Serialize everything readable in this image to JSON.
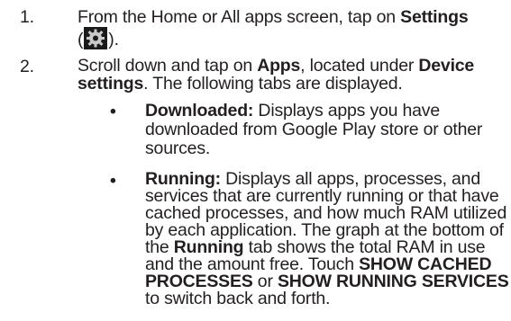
{
  "steps": [
    {
      "number": "1.",
      "text_before": "From the Home or All apps screen, tap on ",
      "bold_1": "Settings",
      "paren_open": "(",
      "icon": "settings-gear-icon",
      "paren_close": ")."
    },
    {
      "number": "2.",
      "text_before": "Scroll down and tap on ",
      "bold_1": "Apps",
      "text_middle": ", located under ",
      "bold_2": "Device settings",
      "text_after": ". The following tabs are displayed."
    }
  ],
  "bullets": [
    {
      "marker": "•",
      "title": "Downloaded:",
      "text": " Displays apps you have downloaded from Google Play store or other sources."
    },
    {
      "marker": "•",
      "title": "Running:",
      "text_1": " Displays all apps, processes, and services that are currently running or that have cached processes, and how much RAM utilized by each application. The graph at the bottom of the ",
      "bold_1": "Running",
      "text_2": " tab shows the total RAM in use and the amount free. Touch ",
      "bold_2": "SHOW CACHED PROCESSES",
      "text_3": " or ",
      "bold_3": "SHOW RUNNING SERVICES",
      "text_4": " to switch back and forth."
    }
  ]
}
